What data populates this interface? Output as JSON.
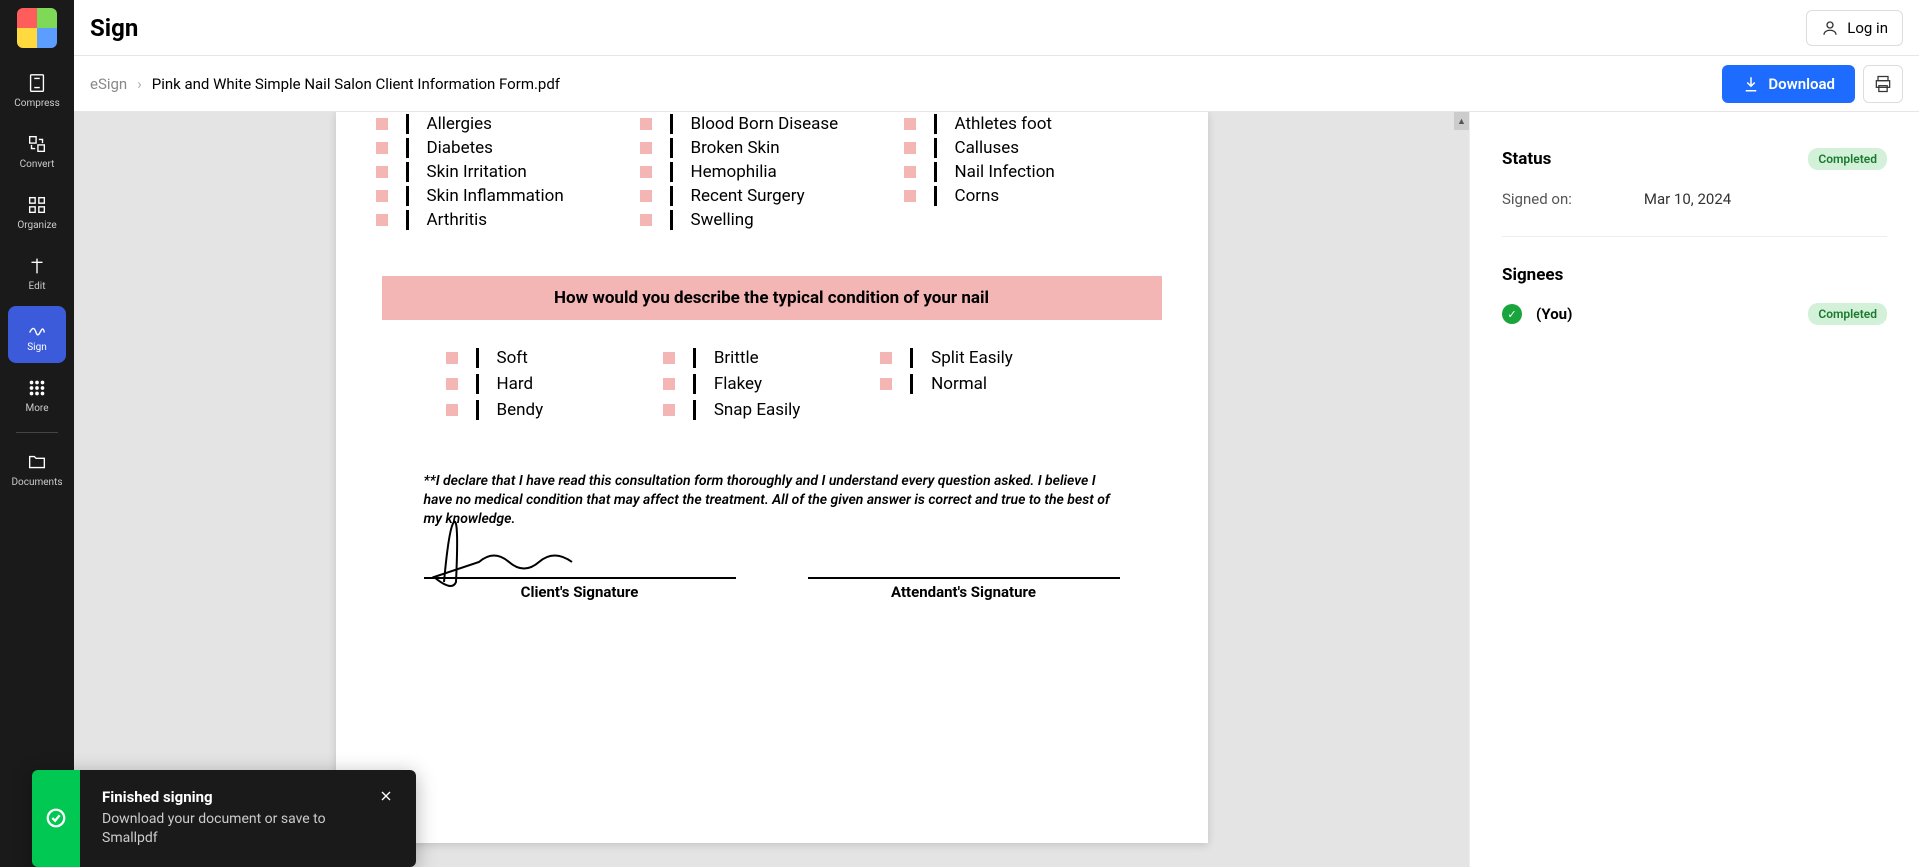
{
  "sidebar": {
    "items": [
      {
        "label": "Compress"
      },
      {
        "label": "Convert"
      },
      {
        "label": "Organize"
      },
      {
        "label": "Edit"
      },
      {
        "label": "Sign"
      },
      {
        "label": "More"
      },
      {
        "label": "Documents"
      }
    ]
  },
  "header": {
    "title": "Sign",
    "login": "Log in"
  },
  "breadcrumb": {
    "root": "eSign",
    "sep": "›",
    "file": "Pink and White Simple Nail Salon Client Information Form.pdf"
  },
  "toolbar": {
    "download": "Download"
  },
  "document": {
    "conditions": {
      "col1": [
        "Allergies",
        "Diabetes",
        "Skin Irritation",
        "Skin Inflammation",
        "Arthritis"
      ],
      "col2": [
        "Blood Born Disease",
        "Broken Skin",
        "Hemophilia",
        "Recent Surgery",
        "Swelling"
      ],
      "col3": [
        "Athletes foot",
        "Calluses",
        "Nail Infection",
        "Corns"
      ]
    },
    "nail_section_heading": "How would you describe the typical condition of your nail",
    "nail_conditions": {
      "col1": [
        "Soft",
        "Hard",
        "Bendy"
      ],
      "col2": [
        "Brittle",
        "Flakey",
        "Snap Easily"
      ],
      "col3": [
        "Split Easily",
        "Normal"
      ]
    },
    "declaration": "**I declare that I have read this consultation form thoroughly and I understand every question asked. I believe I have no medical condition that may affect the treatment. All of the given answer is correct and true to the best of my knowledge.",
    "client_sig_label": "Client's Signature",
    "attendant_sig_label": "Attendant's Signature"
  },
  "right_panel": {
    "status_label": "Status",
    "status_value": "Completed",
    "signed_on_label": "Signed on:",
    "signed_on_value": "Mar 10, 2024",
    "signees_label": "Signees",
    "signee_you": "(You)",
    "signee_status": "Completed"
  },
  "toast": {
    "title": "Finished signing",
    "message": "Download your document or save to Smallpdf"
  }
}
